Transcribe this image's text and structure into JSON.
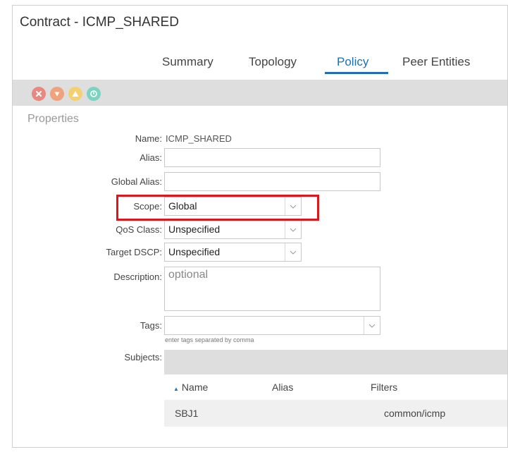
{
  "window": {
    "title": "Contract - ICMP_SHARED"
  },
  "tabs": [
    {
      "label": "Summary",
      "active": false
    },
    {
      "label": "Topology",
      "active": false
    },
    {
      "label": "Policy",
      "active": true
    },
    {
      "label": "Peer Entities",
      "active": false
    }
  ],
  "fault_icons": [
    {
      "name": "critical-fault-icon",
      "color": "#e8887f"
    },
    {
      "name": "major-fault-icon",
      "color": "#f0a27c"
    },
    {
      "name": "minor-fault-icon",
      "color": "#f4d070"
    },
    {
      "name": "warning-fault-icon",
      "color": "#7dd3c2"
    }
  ],
  "properties": {
    "heading": "Properties",
    "name_label": "Name:",
    "name_value": "ICMP_SHARED",
    "alias_label": "Alias:",
    "alias_value": "",
    "global_alias_label": "Global Alias:",
    "global_alias_value": "",
    "scope_label": "Scope:",
    "scope_value": "Global",
    "qos_label": "QoS Class:",
    "qos_value": "Unspecified",
    "dscp_label": "Target DSCP:",
    "dscp_value": "Unspecified",
    "description_label": "Description:",
    "description_placeholder": "optional",
    "tags_label": "Tags:",
    "tags_hint": "enter tags separated by comma",
    "subjects_label": "Subjects:"
  },
  "subjects_table": {
    "columns": [
      "Name",
      "Alias",
      "Filters"
    ],
    "rows": [
      {
        "name": "SBJ1",
        "alias": "",
        "filters": "common/icmp"
      }
    ]
  },
  "colors": {
    "accent": "#1f6fb5",
    "highlight": "#e0141b"
  }
}
